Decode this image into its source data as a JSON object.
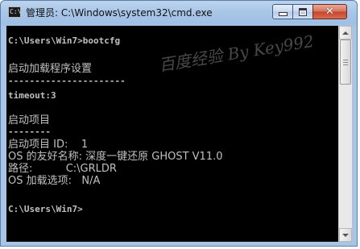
{
  "window": {
    "title": "管理员: C:\\Windows\\system32\\cmd.exe",
    "icon": "cmd-icon",
    "icon_text": "C:\\"
  },
  "controls": {
    "minimize_icon": "minimize-icon",
    "maximize_icon": "maximize-icon",
    "close_icon": "close-icon",
    "close_glyph": "✕"
  },
  "console": {
    "lines": [
      "C:\\Users\\Win7>bootcfg",
      "启动加载程序设置",
      "----------------------",
      "timeout:3",
      "启动项目",
      "--------",
      "启动项目 ID:    1",
      "OS 的友好名称: 深度一键还原 GHOST V11.0",
      "路径:          C:\\GRLDR",
      "OS 加载选项:   N/A",
      "C:\\Users\\Win7>"
    ]
  },
  "watermark": "百度经验 By Key992",
  "scrollbar": {
    "up_icon": "scroll-up-arrow-icon",
    "down_icon": "scroll-down-arrow-icon"
  }
}
